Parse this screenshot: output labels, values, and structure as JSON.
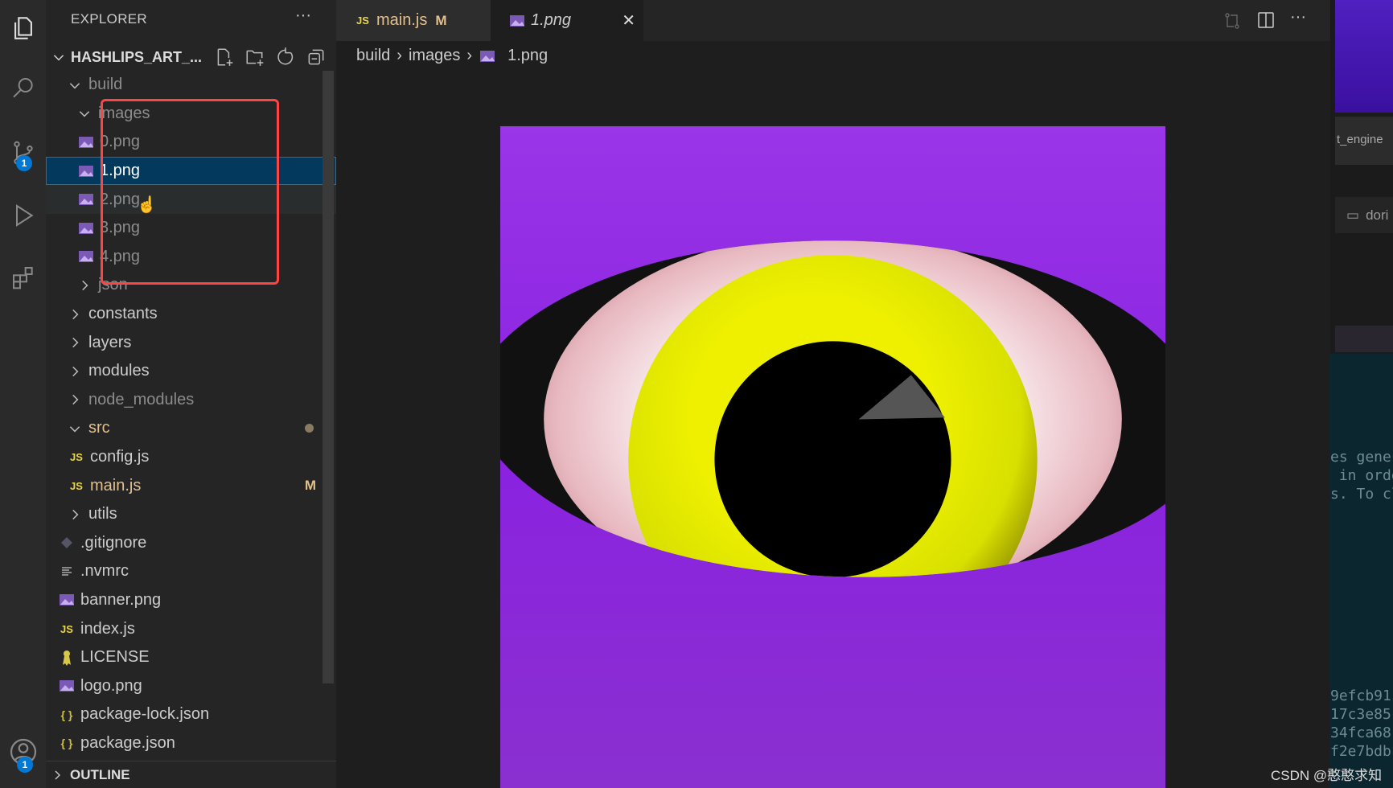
{
  "explorer": {
    "title": "EXPLORER",
    "root": "HASHLIPS_ART_...",
    "more": "···"
  },
  "activity": {
    "scm_badge": "1",
    "account_badge": "1"
  },
  "tree": [
    {
      "name": "build",
      "indent": 1,
      "icon": "chevron-down",
      "color": "#8c8c8c"
    },
    {
      "name": "images",
      "indent": 2,
      "icon": "chevron-down",
      "color": "#8c8c8c"
    },
    {
      "name": "0.png",
      "indent": 3,
      "icon": "image",
      "color": "#8c8c8c"
    },
    {
      "name": "1.png",
      "indent": 3,
      "icon": "image",
      "color": "#ffffff",
      "state": "selected"
    },
    {
      "name": "2.png",
      "indent": 3,
      "icon": "image",
      "color": "#8c8c8c",
      "state": "hover"
    },
    {
      "name": "3.png",
      "indent": 3,
      "icon": "image",
      "color": "#8c8c8c"
    },
    {
      "name": "4.png",
      "indent": 3,
      "icon": "image",
      "color": "#8c8c8c"
    },
    {
      "name": "json",
      "indent": 2,
      "icon": "chevron-right",
      "color": "#8c8c8c"
    },
    {
      "name": "constants",
      "indent": 1,
      "icon": "chevron-right",
      "color": "#cccccc"
    },
    {
      "name": "layers",
      "indent": 1,
      "icon": "chevron-right",
      "color": "#cccccc"
    },
    {
      "name": "modules",
      "indent": 1,
      "icon": "chevron-right",
      "color": "#cccccc"
    },
    {
      "name": "node_modules",
      "indent": 1,
      "icon": "chevron-right",
      "color": "#8c8c8c"
    },
    {
      "name": "src",
      "indent": 1,
      "icon": "chevron-down",
      "color": "#e2c08d",
      "dot": true
    },
    {
      "name": "config.js",
      "indent": 2,
      "icon": "js",
      "color": "#cccccc"
    },
    {
      "name": "main.js",
      "indent": 2,
      "icon": "js",
      "color": "#e2c08d",
      "badge": "M"
    },
    {
      "name": "utils",
      "indent": 1,
      "icon": "chevron-right",
      "color": "#cccccc"
    },
    {
      "name": ".gitignore",
      "indent": 1,
      "icon": "git",
      "color": "#cccccc"
    },
    {
      "name": ".nvmrc",
      "indent": 1,
      "icon": "lines",
      "color": "#cccccc"
    },
    {
      "name": "banner.png",
      "indent": 1,
      "icon": "image",
      "color": "#cccccc"
    },
    {
      "name": "index.js",
      "indent": 1,
      "icon": "js",
      "color": "#cccccc"
    },
    {
      "name": "LICENSE",
      "indent": 1,
      "icon": "license",
      "color": "#cccccc"
    },
    {
      "name": "logo.png",
      "indent": 1,
      "icon": "image",
      "color": "#cccccc"
    },
    {
      "name": "package-lock.json",
      "indent": 1,
      "icon": "json",
      "color": "#cccccc"
    },
    {
      "name": "package.json",
      "indent": 1,
      "icon": "json",
      "color": "#cccccc"
    }
  ],
  "outline": "OUTLINE",
  "tabs": [
    {
      "label": "main.js",
      "badge": "M",
      "icon": "js"
    },
    {
      "label": "1.png",
      "icon": "image",
      "active": true,
      "close": "✕"
    }
  ],
  "breadcrumb": [
    "build",
    "images",
    "1.png"
  ],
  "right_panel": {
    "label": "t_engine",
    "folder": "dori",
    "terminal": [
      "es gener",
      " in orde",
      "s. To cl"
    ],
    "hashes": [
      "9efcb91",
      "17c3e85",
      "34fca68",
      "f2e7bdb"
    ]
  },
  "watermark": "CSDN @憨憨求知",
  "colors": {
    "accent": "#0078d4",
    "selection": "#04395e",
    "modified": "#e2c08d",
    "image_bg": "#8a2be2",
    "iris": "#e6f000",
    "highlight_box": "#ff4444"
  }
}
